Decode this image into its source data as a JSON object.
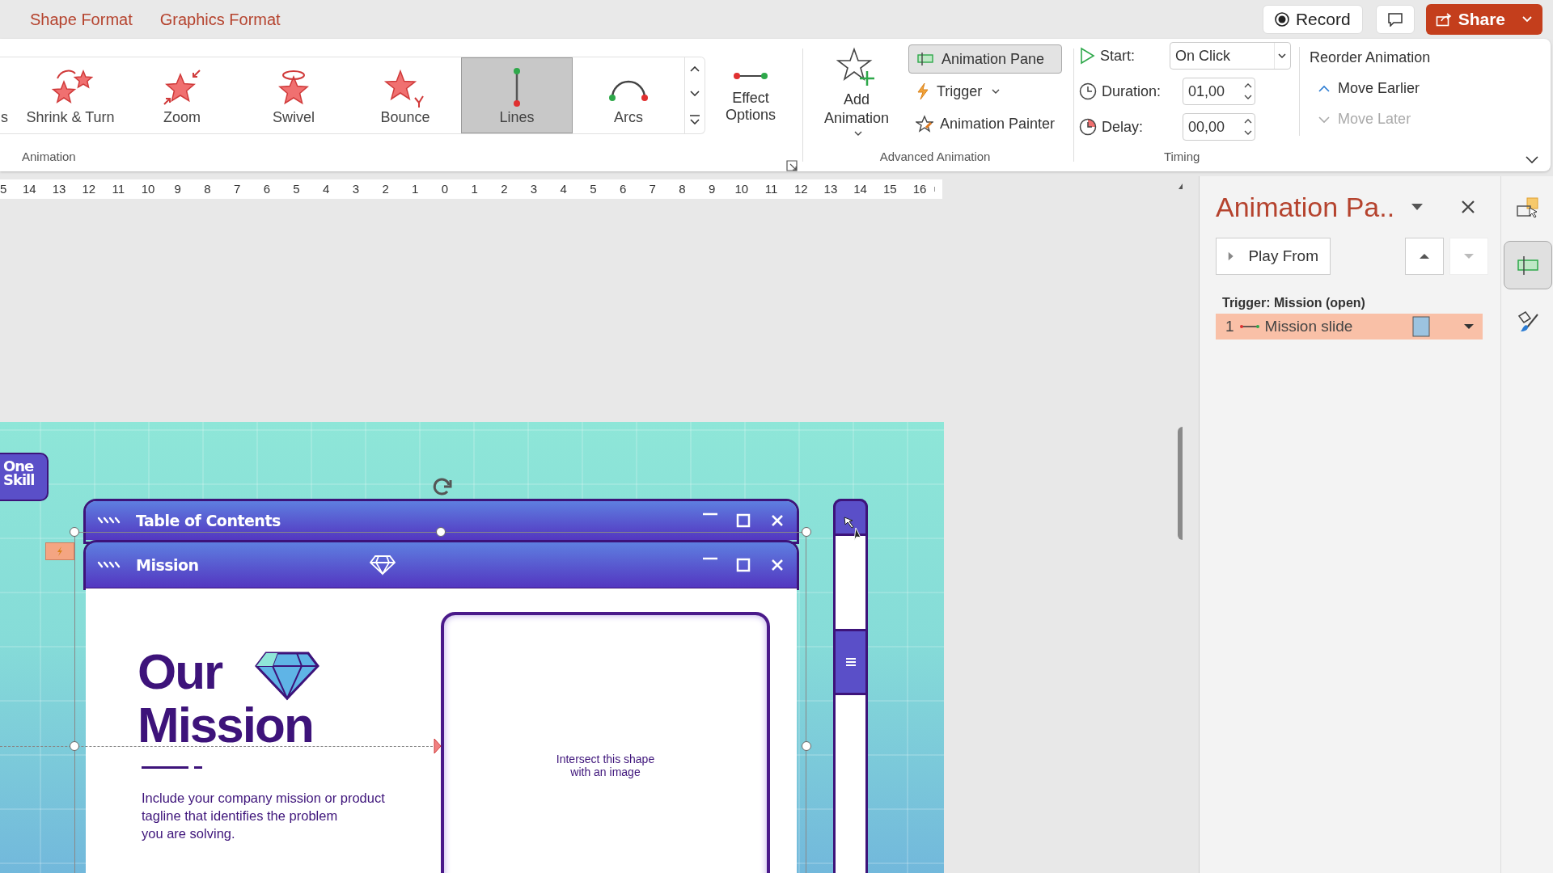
{
  "ribbon_tabs": [
    {
      "label": "Shape Format"
    },
    {
      "label": "Graphics Format"
    }
  ],
  "title_actions": {
    "record": "Record",
    "share": "Share"
  },
  "animation_gallery": {
    "group_label": "Animation",
    "items": [
      {
        "kind": "partial",
        "label": "s",
        "selected": false
      },
      {
        "kind": "shrink-turn",
        "label": "Shrink & Turn",
        "selected": false
      },
      {
        "kind": "zoom",
        "label": "Zoom",
        "selected": false
      },
      {
        "kind": "swivel",
        "label": "Swivel",
        "selected": false
      },
      {
        "kind": "bounce",
        "label": "Bounce",
        "selected": false
      },
      {
        "kind": "lines",
        "label": "Lines",
        "selected": true
      },
      {
        "kind": "arcs",
        "label": "Arcs",
        "selected": false
      }
    ]
  },
  "effect_options": "Effect Options",
  "advanced_animation": {
    "add_animation": "Add Animation",
    "animation_pane": {
      "label": "Animation Pane",
      "on": true
    },
    "trigger": "Trigger",
    "animation_painter": "Animation Painter",
    "group_label": "Advanced Animation"
  },
  "timing": {
    "start": {
      "label": "Start:",
      "value": "On Click"
    },
    "duration": {
      "label": "Duration:",
      "value": "01,00"
    },
    "delay": {
      "label": "Delay:",
      "value": "00,00"
    },
    "group_label": "Timing"
  },
  "reorder": {
    "title": "Reorder Animation",
    "move_earlier": {
      "label": "Move Earlier",
      "disabled": false
    },
    "move_later": {
      "label": "Move Later",
      "disabled": true
    }
  },
  "ruler": {
    "labels": [
      "5",
      "14",
      "13",
      "12",
      "11",
      "10",
      "9",
      "8",
      "7",
      "6",
      "5",
      "4",
      "3",
      "2",
      "1",
      "0",
      "1",
      "2",
      "3",
      "4",
      "5",
      "6",
      "7",
      "8",
      "9",
      "10",
      "11",
      "12",
      "13",
      "14",
      "15",
      "16"
    ]
  },
  "slide": {
    "badge": "One Skill",
    "back_window_title": "Table of Contents",
    "front_window_title": "Mission",
    "heading": [
      "Our",
      "Mission"
    ],
    "body": "Include your company mission or product\ntagline that identifies the problem\nyou are solving.",
    "image_placeholder": "Intersect this shape\nwith an image"
  },
  "animation_pane": {
    "title": "Animation Pa..",
    "play_from": "Play From",
    "move_up_disabled": false,
    "move_down_disabled": true,
    "trigger_label": "Trigger: Mission (open)",
    "items": [
      {
        "number": "1",
        "name": "Mission slide",
        "selected": true
      }
    ]
  },
  "side_strip": [
    {
      "kind": "selection",
      "selected": false
    },
    {
      "kind": "animation",
      "selected": true
    },
    {
      "kind": "design",
      "selected": false
    }
  ]
}
